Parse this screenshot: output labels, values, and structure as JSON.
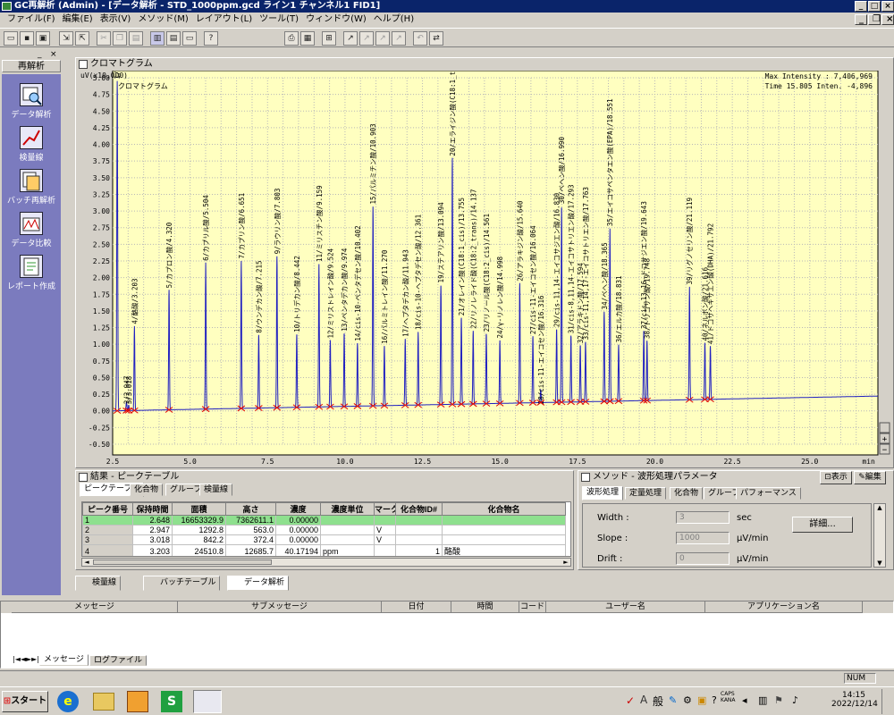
{
  "window": {
    "title": "GC再解析 (Admin) - [データ解析 - STD_1000ppm.gcd ライン1 チャンネル1 FID1]"
  },
  "menu": [
    "ファイル(F)",
    "編集(E)",
    "表示(V)",
    "メソッド(M)",
    "レイアウト(L)",
    "ツール(T)",
    "ウィンドウ(W)",
    "ヘルプ(H)"
  ],
  "toolbar": {
    "icons": [
      "new-icon",
      "save-icon",
      "open-icon",
      "import-icon",
      "export-icon",
      "cut-icon",
      "copy-icon",
      "paste-icon",
      "layout1-icon",
      "layout2-icon",
      "layout3-icon",
      "help-icon",
      "print-icon",
      "print-preview-icon",
      "report-icon",
      "chart1-icon",
      "chart2-icon",
      "chart3-icon",
      "chart4-icon",
      "undo-icon",
      "redo-icon"
    ]
  },
  "nav": {
    "header": "再解析",
    "items": [
      {
        "label": "データ解析",
        "icon": "data-analysis-icon"
      },
      {
        "label": "検量線",
        "icon": "calibration-icon"
      },
      {
        "label": "バッチ再解析",
        "icon": "batch-icon"
      },
      {
        "label": "データ比較",
        "icon": "compare-icon"
      },
      {
        "label": "レポート作成",
        "icon": "report-icon"
      }
    ]
  },
  "chromatogram": {
    "title": "クロマトグラム",
    "y_unit": "uV(x10,000)",
    "sub": "クロマトグラム",
    "max_intensity": "Max Intensity : 7,406,969",
    "cursor": "Time 15.805  Inten.        -4,896",
    "x_unit": "min"
  },
  "chart_data": {
    "type": "line",
    "title": "クロマトグラム",
    "xlabel": "min",
    "ylabel": "uV(x10,000)",
    "xlim": [
      2.5,
      27.2
    ],
    "ylim": [
      -0.5,
      5.0
    ],
    "x_ticks": [
      "2.5",
      "5.0",
      "7.5",
      "10.0",
      "12.5",
      "15.0",
      "17.5",
      "20.0",
      "22.5",
      "25.0",
      "min"
    ],
    "y_ticks": [
      "5.00",
      "4.75",
      "4.50",
      "4.25",
      "4.00",
      "3.75",
      "3.50",
      "3.25",
      "3.00",
      "2.75",
      "2.50",
      "2.25",
      "2.00",
      "1.75",
      "1.50",
      "1.25",
      "1.00",
      "0.75",
      "0.50",
      "0.25",
      "0.00",
      "-0.25",
      "-0.50"
    ],
    "grid": true,
    "peaks": [
      {
        "t": 2.648,
        "h": 4.95,
        "label": "1/2.648"
      },
      {
        "t": 2.947,
        "h": 0.13,
        "label": "2/2.947"
      },
      {
        "t": 3.018,
        "h": 0.08,
        "label": "3/3.018"
      },
      {
        "t": 3.203,
        "h": 1.27,
        "label": "4/酪酸/3.203"
      },
      {
        "t": 4.32,
        "h": 1.8,
        "label": "5/カプロン酸/4.320"
      },
      {
        "t": 5.504,
        "h": 2.2,
        "label": "6/カプリル酸/5.504"
      },
      {
        "t": 6.651,
        "h": 2.22,
        "label": "7/カプリン酸/6.651"
      },
      {
        "t": 7.215,
        "h": 1.1,
        "label": "8/ウンデカン酸/7.215"
      },
      {
        "t": 7.803,
        "h": 2.28,
        "label": "9/ラウリン酸/7.803"
      },
      {
        "t": 8.442,
        "h": 1.1,
        "label": "10/トリデカン酸/8.442"
      },
      {
        "t": 9.159,
        "h": 2.15,
        "label": "11/ミリスチン酸/9.159"
      },
      {
        "t": 9.524,
        "h": 1.0,
        "label": "12/ミリストレイン酸/9.524"
      },
      {
        "t": 9.974,
        "h": 1.1,
        "label": "13/ペンタデカン酸/9.974"
      },
      {
        "t": 10.402,
        "h": 0.95,
        "label": "14/cis-10-ペンタデセン酸/10.402"
      },
      {
        "t": 10.903,
        "h": 3.0,
        "label": "15/パルミチン酸/10.903"
      },
      {
        "t": 11.27,
        "h": 0.9,
        "label": "16/パルミトレイン酸/11.270"
      },
      {
        "t": 11.943,
        "h": 1.0,
        "label": "17/ヘプタデカン酸/11.943"
      },
      {
        "t": 12.361,
        "h": 1.1,
        "label": "18/cis-10-ヘプタデセン酸/12.361"
      },
      {
        "t": 13.094,
        "h": 1.8,
        "label": "19/ステアリン酸/13.094"
      },
      {
        "t": 13.464,
        "h": 3.7,
        "label": "20/エライジン酸(C18:1_trans)/13.464"
      },
      {
        "t": 13.755,
        "h": 1.3,
        "label": "21/オレイン酸(C18:1_cis)/13.755"
      },
      {
        "t": 14.137,
        "h": 1.1,
        "label": "22/リノレライド酸(C18:2_trans)/14.137"
      },
      {
        "t": 14.561,
        "h": 1.05,
        "label": "23/リノール酸(C18:2_cis)/14.561"
      },
      {
        "t": 14.998,
        "h": 0.95,
        "label": "24/γ-リノレン酸/14.998"
      },
      {
        "t": 15.64,
        "h": 1.8,
        "label": "26/アラキジン酸/15.640"
      },
      {
        "t": 16.064,
        "h": 1.0,
        "label": "27/cis-11-エイコセン酸/16.064"
      },
      {
        "t": 16.316,
        "h": 0.2,
        "label": "28/cis-11-エイコセン酸/16.316"
      },
      {
        "t": 16.83,
        "h": 1.1,
        "label": "29/cis-11,14-エイコサジエン酸/16.830"
      },
      {
        "t": 16.99,
        "h": 2.95,
        "label": "30/ベヘン酸/16.990"
      },
      {
        "t": 17.293,
        "h": 1.0,
        "label": "31/cis-8,11,14-エイコサトリエン酸/17.293"
      },
      {
        "t": 17.594,
        "h": 0.85,
        "label": "32/アラキドン酸/17.594"
      },
      {
        "t": 17.763,
        "h": 0.9,
        "label": "33/cis-11,14,17-エイコサトリエン酸/17.763"
      },
      {
        "t": 18.365,
        "h": 1.35,
        "label": "34/ベヘン酸/18.365"
      },
      {
        "t": 18.551,
        "h": 2.6,
        "label": "35/エイコサペンタエン酸(EPA)/18.551"
      },
      {
        "t": 18.831,
        "h": 0.85,
        "label": "36/エルカ酸/18.831"
      },
      {
        "t": 19.643,
        "h": 1.05,
        "label": "37/cis-13,16-ドコサジエン酸/19.643"
      },
      {
        "t": 19.748,
        "h": 0.9,
        "label": "38/トリコサン酸/19.748"
      },
      {
        "t": 21.119,
        "h": 1.7,
        "label": "39/リグノセリン酸/21.119"
      },
      {
        "t": 21.616,
        "h": 0.85,
        "label": "40/ネルボン酸/21.616"
      },
      {
        "t": 21.792,
        "h": 0.8,
        "label": "41/ドコサヘキサエン酸(DHA)/21.792"
      }
    ]
  },
  "results": {
    "title": "結果 - ピークテーブル",
    "tabs": [
      "ピークテーブル",
      "化合物",
      "グループ",
      "検量線"
    ],
    "columns": [
      "ピーク番号",
      "保持時間",
      "面積",
      "高さ",
      "濃度",
      "濃度単位",
      "マーク",
      "化合物ID#",
      "化合物名"
    ],
    "rows": [
      [
        "1",
        "2.648",
        "16653329.9",
        "7362611.1",
        "0.00000",
        "",
        "",
        "",
        ""
      ],
      [
        "2",
        "2.947",
        "1292.8",
        "563.0",
        "0.00000",
        "",
        "V",
        "",
        ""
      ],
      [
        "3",
        "3.018",
        "842.2",
        "372.4",
        "0.00000",
        "",
        "V",
        "",
        ""
      ],
      [
        "4",
        "3.203",
        "24510.8",
        "12685.7",
        "40.17194",
        "ppm",
        "",
        "1",
        "酪酸"
      ]
    ]
  },
  "method": {
    "title": "メソッド - 波形処理パラメータ",
    "display_btn": "表示",
    "edit_btn": "編集",
    "tabs": [
      "波形処理",
      "定量処理",
      "化合物",
      "グループ",
      "パフォーマンス"
    ],
    "fields": [
      {
        "label": "Width :",
        "value": "3",
        "unit": "sec"
      },
      {
        "label": "Slope :",
        "value": "1000",
        "unit": "μV/min"
      },
      {
        "label": "Drift :",
        "value": "0",
        "unit": "μV/min"
      }
    ],
    "detail_btn": "詳細..."
  },
  "bottom_tabs": [
    "検量線",
    "バッチテーブル",
    "データ解析"
  ],
  "messages": {
    "columns": [
      "メッセージ",
      "サブメッセージ",
      "日付",
      "時間",
      "コード",
      "ユーザー名",
      "アプリケーション名"
    ],
    "tabs": [
      "メッセージ",
      "ログファイル"
    ]
  },
  "status": {
    "num": "NUM"
  },
  "taskbar": {
    "start": "スタート",
    "ime": "般",
    "caps": "CAPS",
    "kana": "KANA",
    "time": "14:15",
    "date": "2022/12/14"
  },
  "colors": {
    "chart_bg": "#ffffc0",
    "grid": "#b8b8b8",
    "trace": "#2020c0",
    "nav_bg": "#7b7bbe",
    "title_bg": "#0a246a",
    "row_hl": "#8ee08e",
    "marker": "#e00000"
  }
}
